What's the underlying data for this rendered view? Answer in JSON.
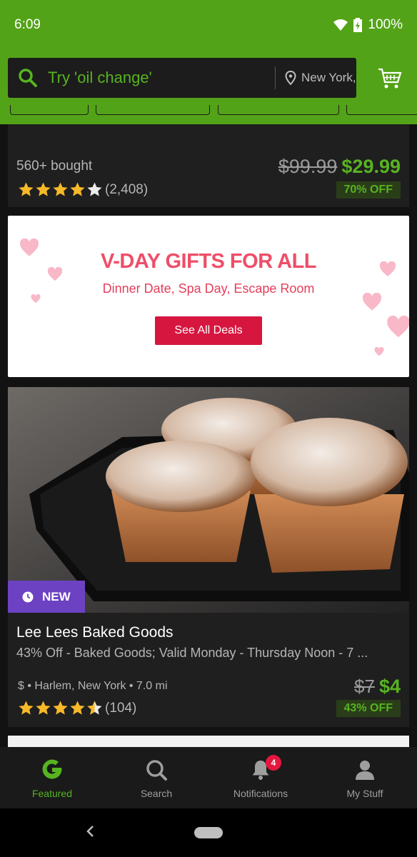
{
  "status_bar": {
    "time": "6:09",
    "battery": "100%"
  },
  "search": {
    "placeholder": "Try 'oil change'",
    "location": "New York,"
  },
  "deal1": {
    "bought": "560+ bought",
    "rating": 4.5,
    "rating_count": "(2,408)",
    "old_price": "$99.99",
    "new_price": "$29.99",
    "discount": "70% OFF"
  },
  "promo": {
    "title": "V-DAY GIFTS FOR ALL",
    "subtitle": "Dinner Date, Spa Day, Escape Room",
    "button": "See All Deals"
  },
  "deal2": {
    "badge": "NEW",
    "name": "Lee Lees Baked Goods",
    "description": "43% Off - Baked Goods; Valid Monday - Thursday Noon - 7 ...",
    "location": "$ • Harlem, New York • 7.0 mi",
    "rating": 4.5,
    "rating_count": "(104)",
    "old_price": "$7",
    "new_price": "$4",
    "discount": "43% OFF"
  },
  "bottom_nav": {
    "items": [
      {
        "label": "Featured",
        "icon": "groupon-g-icon",
        "active": true
      },
      {
        "label": "Search",
        "icon": "search-icon",
        "active": false
      },
      {
        "label": "Notifications",
        "icon": "bell-icon",
        "active": false,
        "badge": "4"
      },
      {
        "label": "My Stuff",
        "icon": "person-icon",
        "active": false
      }
    ]
  },
  "colors": {
    "brand_green": "#53a318",
    "price_green": "#57b320",
    "promo_red": "#d6163f",
    "new_badge_purple": "#6c42c2"
  }
}
